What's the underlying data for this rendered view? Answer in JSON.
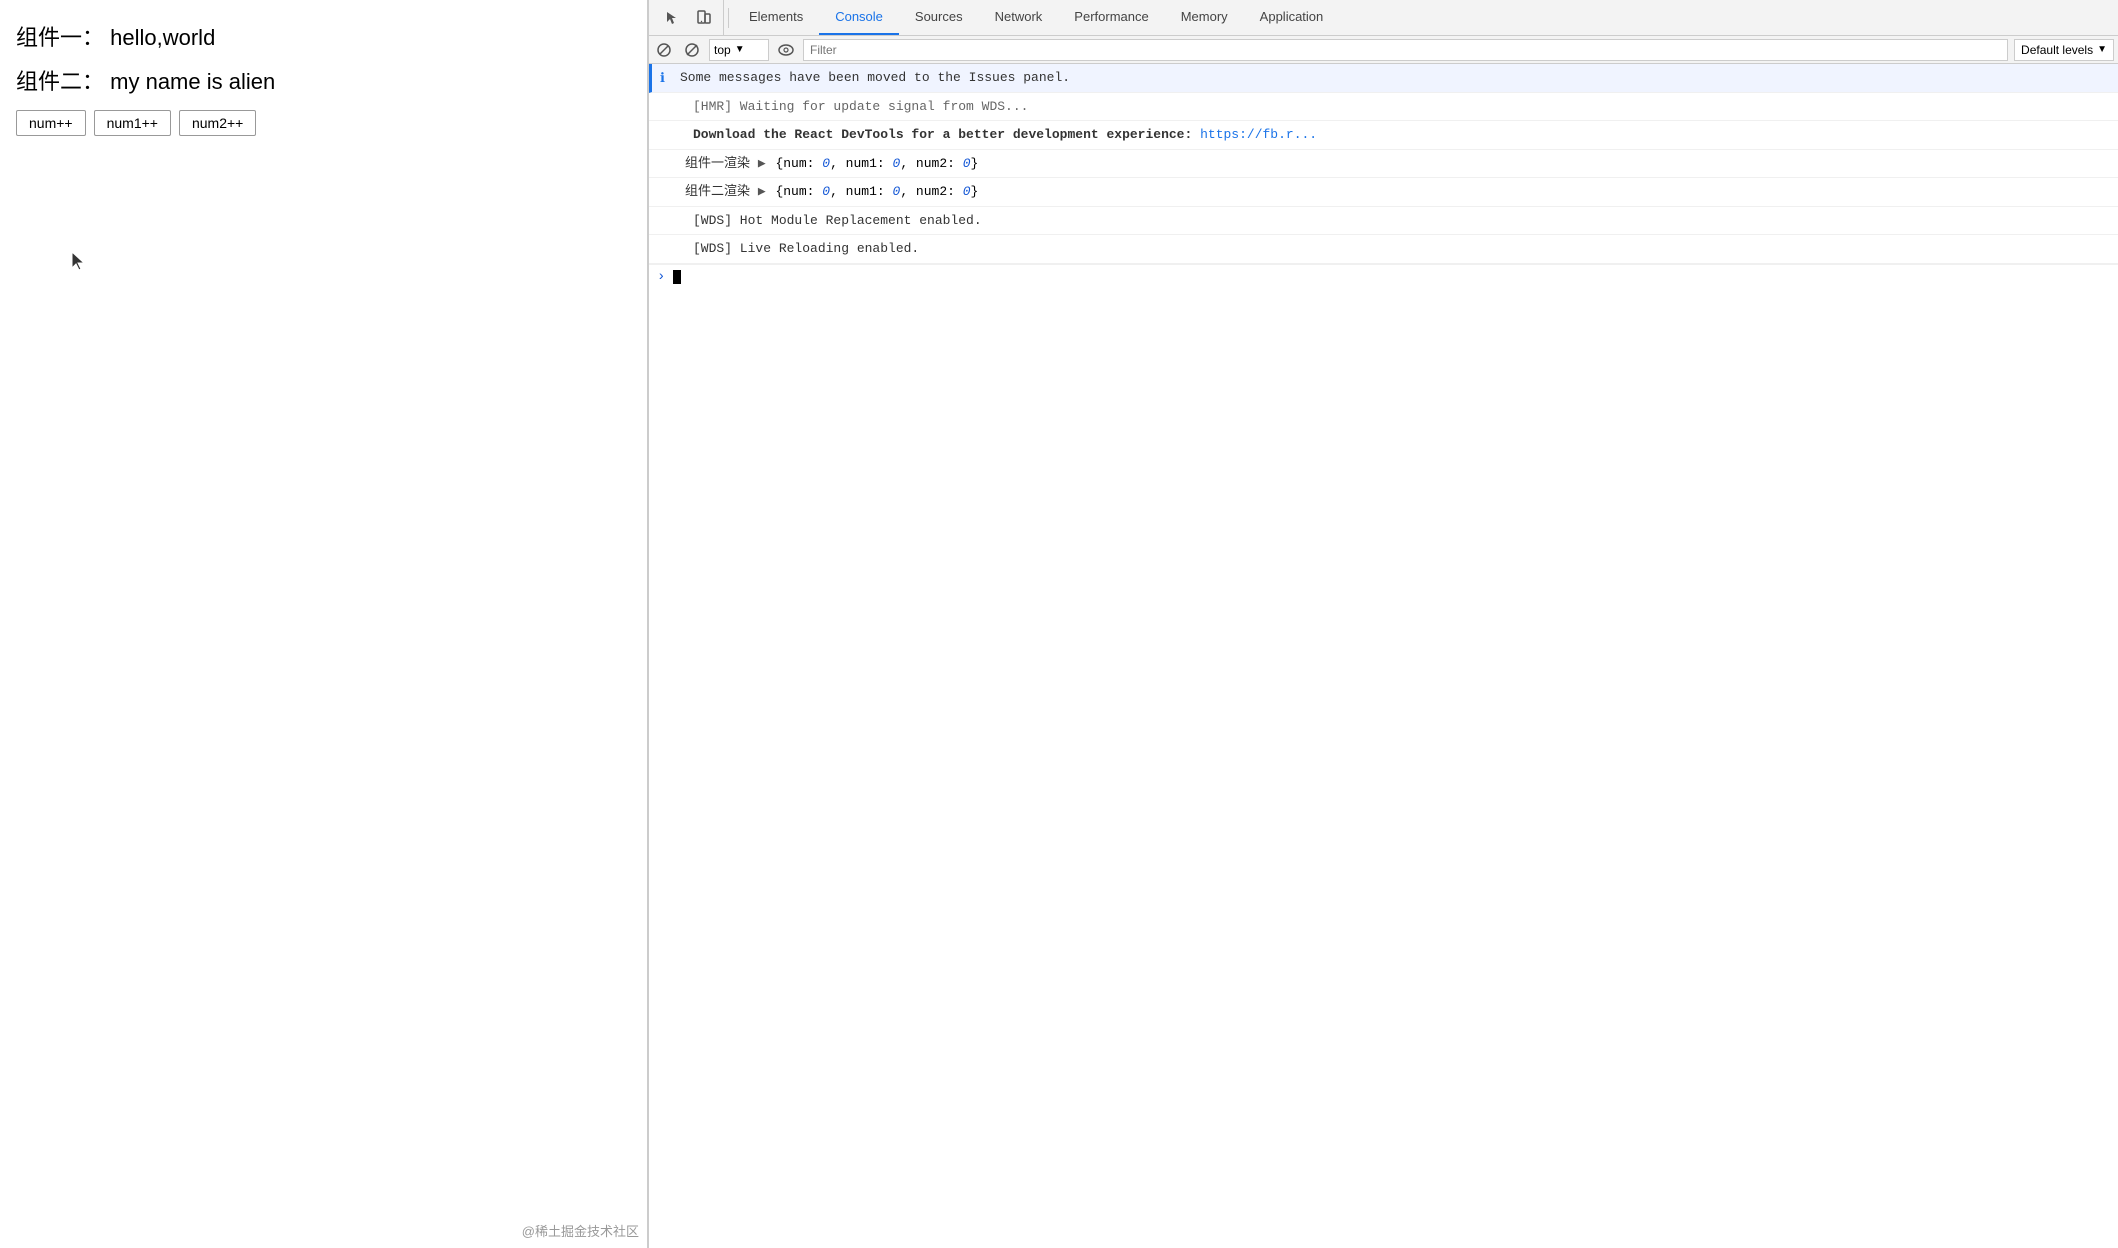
{
  "app": {
    "component1_label": "组件一：",
    "component1_value": "hello,world",
    "component2_label": "组件二：",
    "component2_value": "my name is alien",
    "button1": "num++",
    "button2": "num1++",
    "button3": "num2++",
    "watermark": "@稀土掘金技术社区"
  },
  "devtools": {
    "tabs": [
      {
        "id": "elements",
        "label": "Elements",
        "active": false
      },
      {
        "id": "console",
        "label": "Console",
        "active": true
      },
      {
        "id": "sources",
        "label": "Sources",
        "active": false
      },
      {
        "id": "network",
        "label": "Network",
        "active": false
      },
      {
        "id": "performance",
        "label": "Performance",
        "active": false
      },
      {
        "id": "memory",
        "label": "Memory",
        "active": false
      },
      {
        "id": "application",
        "label": "Application",
        "active": false
      }
    ],
    "console": {
      "top_select": "top",
      "filter_placeholder": "Filter",
      "levels_label": "Default levels",
      "messages": [
        {
          "type": "info",
          "text": "Some messages have been moved to the Issues panel."
        },
        {
          "type": "log-gray",
          "text": "[HMR] Waiting for update signal from WDS..."
        },
        {
          "type": "log-bold",
          "prefix": "Download the React DevTools for a better development experience: ",
          "link": "https://fb.me/react-devtools",
          "link_display": "https://fb.r..."
        },
        {
          "type": "log-obj",
          "label": "组件一渲染",
          "obj": "{num: 0, num1: 0, num2: 0}"
        },
        {
          "type": "log-obj",
          "label": "组件二渲染",
          "obj": "{num: 0, num1: 0, num2: 0}"
        },
        {
          "type": "log",
          "text": "[WDS] Hot Module Replacement enabled."
        },
        {
          "type": "log",
          "text": "[WDS] Live Reloading enabled."
        }
      ]
    }
  }
}
